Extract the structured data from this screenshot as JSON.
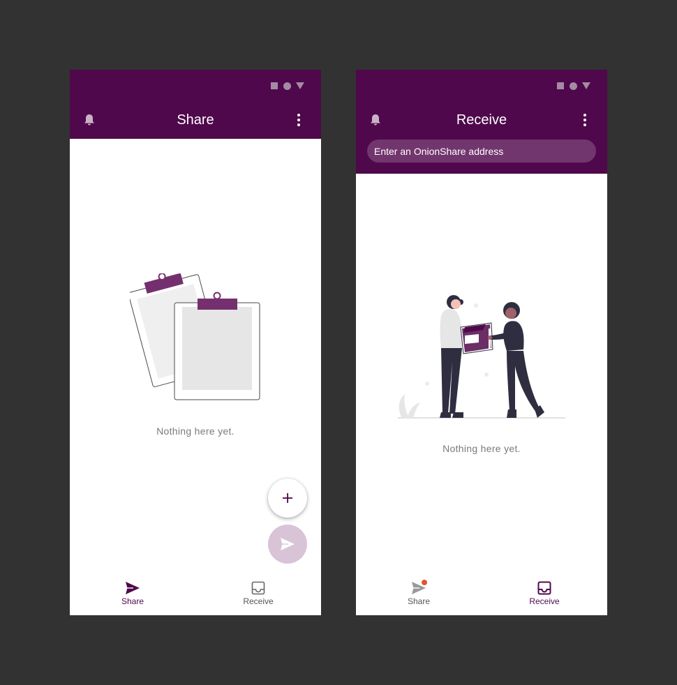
{
  "share_screen": {
    "title": "Share",
    "empty_text": "Nothing here yet.",
    "nav": {
      "share_label": "Share",
      "receive_label": "Receive",
      "active": "share"
    },
    "icons": {
      "notifications": "bell-icon",
      "menu": "more-vert-icon",
      "add_fab": "plus-icon",
      "send_fab": "send-icon"
    }
  },
  "receive_screen": {
    "title": "Receive",
    "address_placeholder": "Enter an OnionShare address",
    "empty_text": "Nothing here yet.",
    "nav": {
      "share_label": "Share",
      "receive_label": "Receive",
      "active": "receive",
      "share_badge": true
    },
    "icons": {
      "notifications": "bell-icon",
      "menu": "more-vert-icon"
    }
  },
  "colors": {
    "brand": "#4f084b",
    "app_bar": "#4f084b",
    "address_field": "#72366e",
    "fab_send_disabled": "#d8c4d6",
    "badge": "#e05533",
    "background": "#323232"
  }
}
